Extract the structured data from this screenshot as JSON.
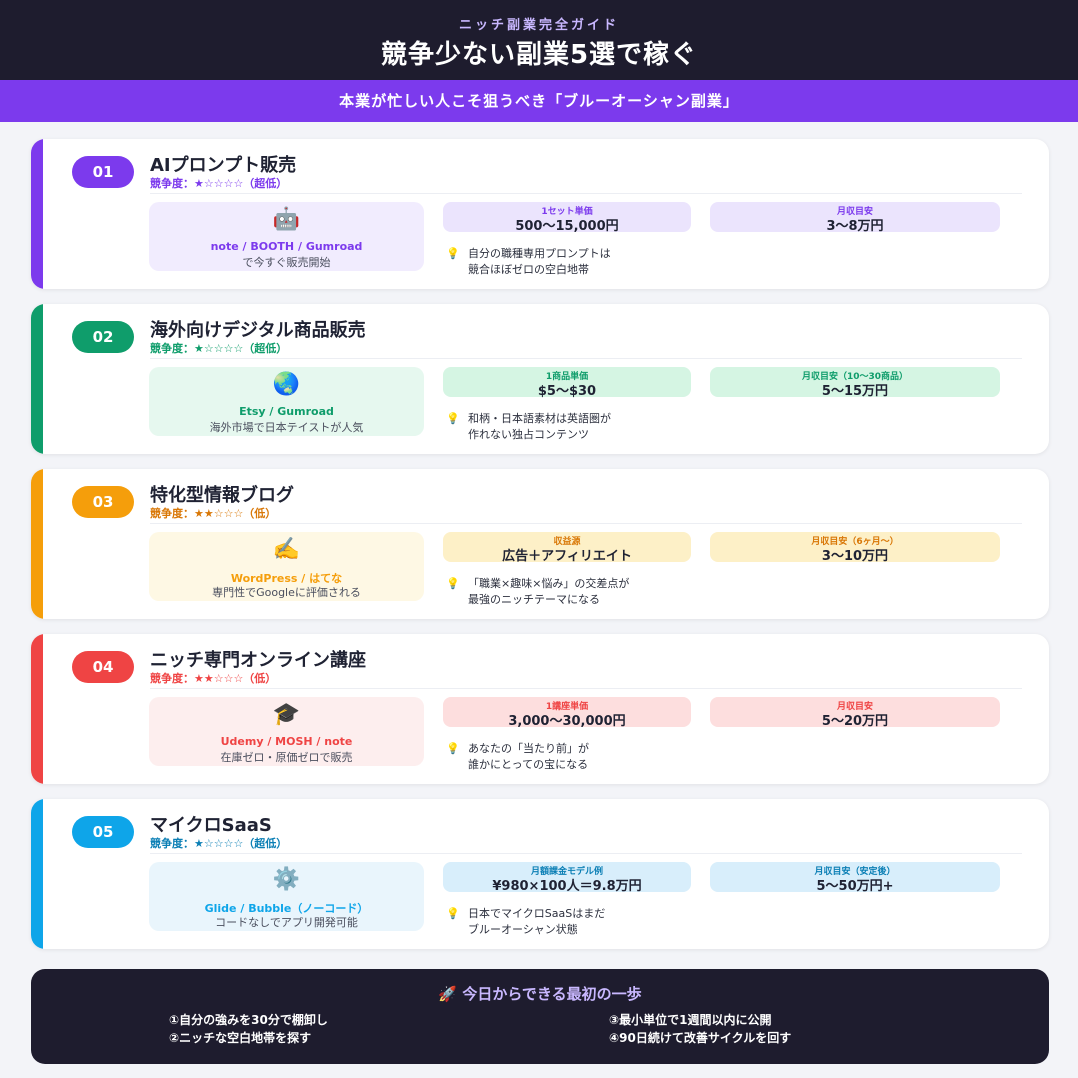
{
  "header": {
    "kicker": "ニッチ副業完全ガイド",
    "title": "競争少ない副業5選で稼ぐ",
    "subtitle": "本業が忙しい人こそ狙うべき「ブルーオーシャン副業」"
  },
  "colors": {
    "purple": "#7c3aed",
    "green": "#0f9d6b",
    "orange": "#f59e0b",
    "red": "#ef4444",
    "blue": "#0ea5e9",
    "dark": "#1e1c2e"
  },
  "items": [
    {
      "num": "01",
      "name": "AIプロンプト販売",
      "competition": "競争度：★☆☆☆☆（超低）",
      "icon": "robot-icon",
      "icon_glyph": "🤖",
      "platforms": "note / BOOTH / Gumroad",
      "platform_desc": "で今すぐ販売開始",
      "stat1_label": "1セット単価",
      "stat1_value": "500〜15,000円",
      "stat2_label": "月収目安",
      "stat2_value": "3〜8万円",
      "tip_line1": "自分の職種専用プロンプトは",
      "tip_line2": "競合ほぼゼロの空白地帯"
    },
    {
      "num": "02",
      "name": "海外向けデジタル商品販売",
      "competition": "競争度：★☆☆☆☆（超低）",
      "icon": "globe-icon",
      "icon_glyph": "🌏",
      "platforms": "Etsy / Gumroad",
      "platform_desc": "海外市場で日本テイストが人気",
      "stat1_label": "1商品単価",
      "stat1_value": "$5〜$30",
      "stat2_label": "月収目安（10〜30商品）",
      "stat2_value": "5〜15万円",
      "tip_line1": "和柄・日本語素材は英語圏が",
      "tip_line2": "作れない独占コンテンツ"
    },
    {
      "num": "03",
      "name": "特化型情報ブログ",
      "competition": "競争度：★★☆☆☆（低）",
      "icon": "writing-hand-icon",
      "icon_glyph": "✍️",
      "platforms": "WordPress / はてな",
      "platform_desc": "専門性でGoogleに評価される",
      "stat1_label": "収益源",
      "stat1_value": "広告＋アフィリエイト",
      "stat2_label": "月収目安（6ヶ月〜）",
      "stat2_value": "3〜10万円",
      "tip_line1": "「職業×趣味×悩み」の交差点が",
      "tip_line2": "最強のニッチテーマになる"
    },
    {
      "num": "04",
      "name": "ニッチ専門オンライン講座",
      "competition": "競争度：★★☆☆☆（低）",
      "icon": "graduation-cap-icon",
      "icon_glyph": "🎓",
      "platforms": "Udemy / MOSH / note",
      "platform_desc": "在庫ゼロ・原価ゼロで販売",
      "stat1_label": "1講座単価",
      "stat1_value": "3,000〜30,000円",
      "stat2_label": "月収目安",
      "stat2_value": "5〜20万円",
      "tip_line1": "あなたの「当たり前」が",
      "tip_line2": "誰かにとっての宝になる"
    },
    {
      "num": "05",
      "name": "マイクロSaaS",
      "competition": "競争度：★☆☆☆☆（超低）",
      "icon": "gear-icon",
      "icon_glyph": "⚙️",
      "platforms": "Glide / Bubble（ノーコード）",
      "platform_desc": "コードなしでアプリ開発可能",
      "stat1_label": "月額課金モデル例",
      "stat1_value": "¥980×100人＝9.8万円",
      "stat2_label": "月収目安（安定後）",
      "stat2_value": "5〜50万円+",
      "tip_line1": "日本でマイクロSaaSはまだ",
      "tip_line2": "ブルーオーシャン状態"
    }
  ],
  "footer": {
    "title": "🚀 今日からできる最初の一歩",
    "steps": [
      "①自分の強みを30分で棚卸し",
      "②ニッチな空白地帯を探す",
      "③最小単位で1週間以内に公開",
      "④90日続けて改善サイクルを回す"
    ]
  }
}
